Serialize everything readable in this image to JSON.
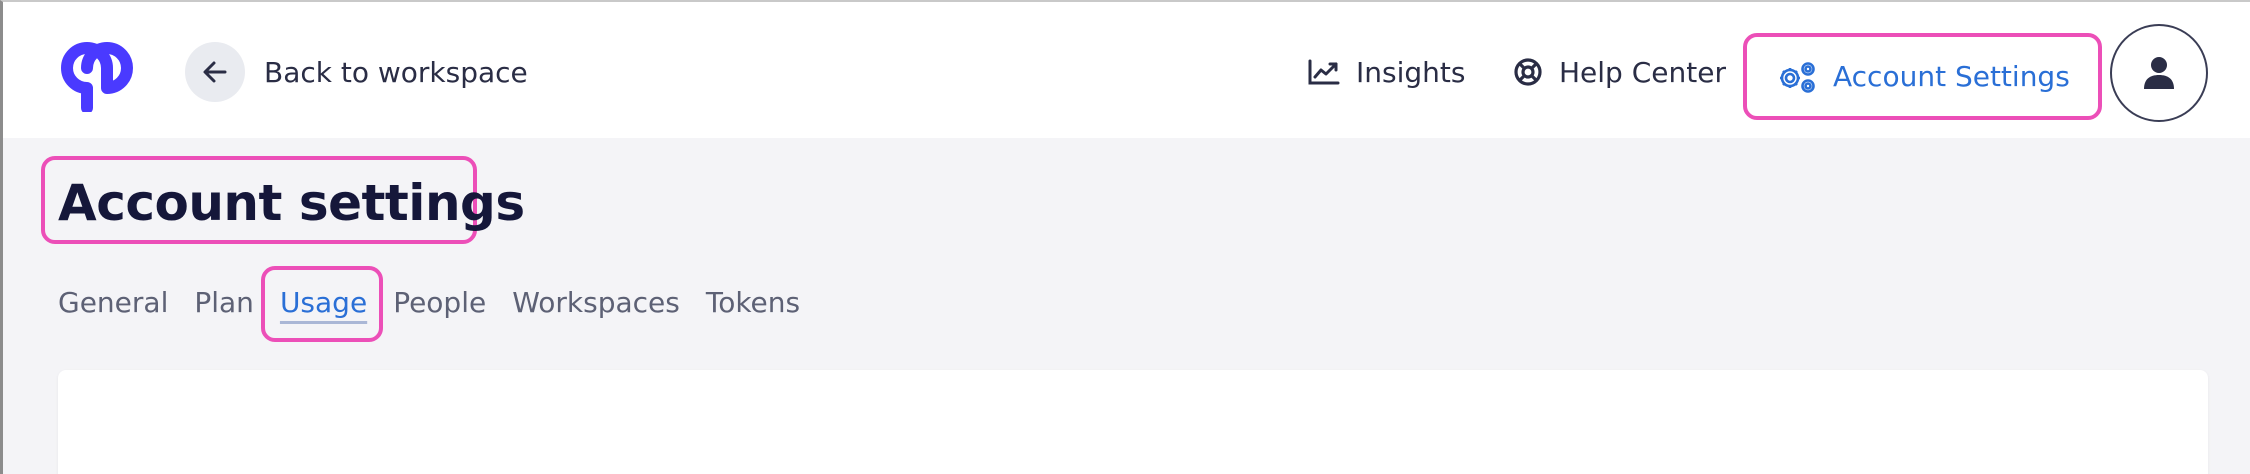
{
  "header": {
    "logo_name": "app-logo",
    "back_label": "Back to workspace",
    "nav": {
      "insights": "Insights",
      "help_center": "Help Center",
      "account_settings": "Account Settings"
    },
    "avatar_icon": "user-icon"
  },
  "page": {
    "title": "Account settings",
    "tabs": [
      "General",
      "Plan",
      "Usage",
      "People",
      "Workspaces",
      "Tokens"
    ],
    "active_tab": "Usage"
  },
  "colors": {
    "brand": "#4a3aff",
    "accent_blue": "#2a6fd6",
    "highlight_pink": "#ec4fb8",
    "text_dark": "#15173a",
    "text_muted": "#5d6175",
    "content_bg": "#f4f4f7"
  }
}
